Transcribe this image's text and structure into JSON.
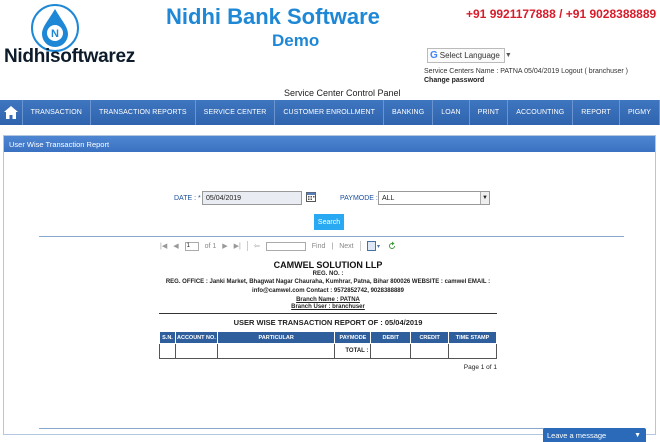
{
  "header": {
    "logo_text": "Nidhisoftwarez",
    "logo_letter": "N",
    "title": "Nidhi Bank Software",
    "subtitle": "Demo",
    "phones": "+91 9921177888 / +91 9028388889",
    "language_label": "Select Language",
    "service_center_line": "Service Centers Name : PATNA     05/04/2019     Logout ( branchuser )",
    "change_password": "Change password",
    "panel_title": "Service Center Control Panel"
  },
  "nav": {
    "items": [
      "TRANSACTION",
      "TRANSACTION REPORTS",
      "SERVICE CENTER",
      "CUSTOMER ENROLLMENT",
      "BANKING",
      "LOAN",
      "PRINT",
      "ACCOUNTING",
      "REPORT",
      "PIGMY"
    ]
  },
  "panel": {
    "heading": "User Wise Transaction Report",
    "date_label": "DATE : *",
    "date_value": "05/04/2019",
    "paymode_label": "PAYMODE :",
    "paymode_value": "ALL",
    "search_label": "Search"
  },
  "toolbar": {
    "page_value": "1",
    "of_text": "of 1",
    "find_label": "Find",
    "next_label": "Next"
  },
  "report": {
    "company": "CAMWEL SOLUTION LLP",
    "reg_no": "REG. NO. :",
    "address_line1": "REG. OFFICE : Janki Market, Bhagwat Nagar Chauraha, Kumhrar, Patna, Bihar 800026 WEBSITE : camwel     EMAIL :",
    "address_line2": "info@camwel.com     Contact : 9572852742, 9028388889",
    "branch_name": "Branch Name : PATNA",
    "branch_user": "Branch User : branchuser",
    "title": "USER WISE TRANSACTION REPORT OF : 05/04/2019",
    "columns": [
      "S.N.",
      "ACCOUNT NO.",
      "PARTICULAR",
      "PAYMODE",
      "DEBIT",
      "CREDIT",
      "TIME STAMP"
    ],
    "total_label": "TOTAL :",
    "page_of": "Page 1 of 1"
  },
  "chat": {
    "label": "Leave a message"
  },
  "colors": {
    "nav": "#3f76c0",
    "panel_head": "#4f86d2",
    "search": "#28a9f2",
    "title": "#1e88d6",
    "phones": "#d81b2a"
  }
}
